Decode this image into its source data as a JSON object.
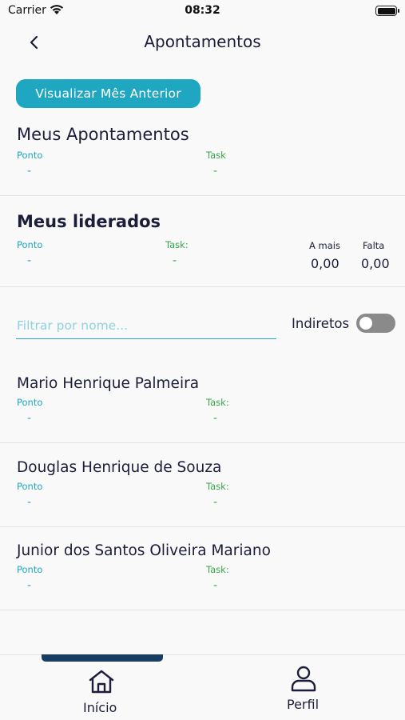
{
  "status_bar": {
    "carrier": "Carrier",
    "time": "08:32"
  },
  "header": {
    "title": "Apontamentos"
  },
  "actions": {
    "prev_month_label": "Visualizar Mês Anterior"
  },
  "my_entries": {
    "title": "Meus Apontamentos",
    "ponto_label": "Ponto",
    "ponto_value": "-",
    "task_label": "Task",
    "task_value": "-"
  },
  "led": {
    "title": "Meus liderados",
    "ponto_label": "Ponto",
    "ponto_value": "-",
    "task_label": "Task:",
    "task_value": "-",
    "a_mais_label": "A mais",
    "a_mais_value": "0,00",
    "falta_label": "Falta",
    "falta_value": "0,00"
  },
  "filter": {
    "placeholder": "Filtrar por nome...",
    "value": "",
    "indiretos_label": "Indiretos",
    "indiretos_on": false
  },
  "people": [
    {
      "name": "Mario Henrique Palmeira",
      "ponto_label": "Ponto",
      "ponto_value": "-",
      "task_label": "Task:",
      "task_value": "-"
    },
    {
      "name": "Douglas Henrique de Souza",
      "ponto_label": "Ponto",
      "ponto_value": "-",
      "task_label": "Task:",
      "task_value": "-"
    },
    {
      "name": "Junior dos Santos Oliveira Mariano",
      "ponto_label": "Ponto",
      "ponto_value": "-",
      "task_label": "Task:",
      "task_value": "-"
    }
  ],
  "tabs": [
    {
      "label": "Início",
      "icon": "home-icon",
      "active": true
    },
    {
      "label": "Perfil",
      "icon": "user-icon",
      "active": false
    }
  ],
  "colors": {
    "accent": "#1fa7c2",
    "task_green": "#37a54a",
    "text_dark": "#1b1d3a",
    "tab_indicator": "#173d63"
  }
}
